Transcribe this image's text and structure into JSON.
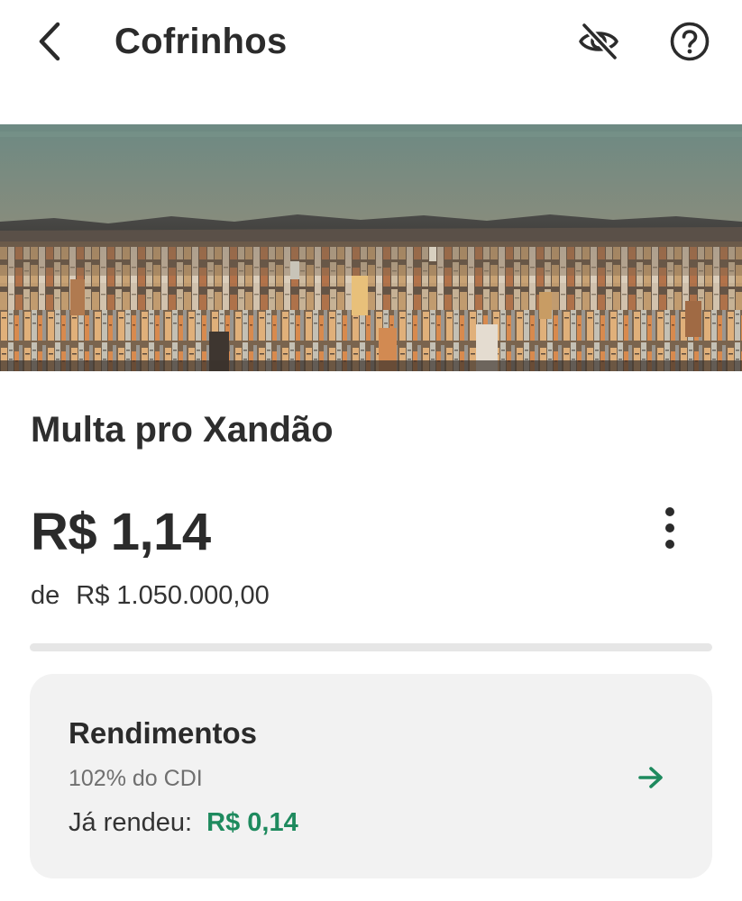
{
  "header": {
    "title": "Cofrinhos",
    "back_icon": "chevron-left-icon",
    "hide_values_icon": "eye-off-icon",
    "help_icon": "help-circle-icon"
  },
  "hero_image": {
    "subject": "city-skyline-photo"
  },
  "goal": {
    "name": "Multa pro Xandão",
    "balance": "R$ 1,14",
    "target_prefix": "de",
    "target_value": "R$ 1.050.000,00",
    "progress_fraction": 1.1e-06,
    "menu_icon": "more-vertical-icon"
  },
  "earnings_card": {
    "title": "Rendimentos",
    "rate": "102% do CDI",
    "earned_label": "Já rendeu:",
    "earned_value": "R$ 0,14",
    "arrow_icon": "arrow-right-icon"
  },
  "colors": {
    "accent_green": "#1e8a5e",
    "text_primary": "#2b2b2b",
    "card_background": "#f2f2f2",
    "progress_track": "#e6e6e6"
  }
}
